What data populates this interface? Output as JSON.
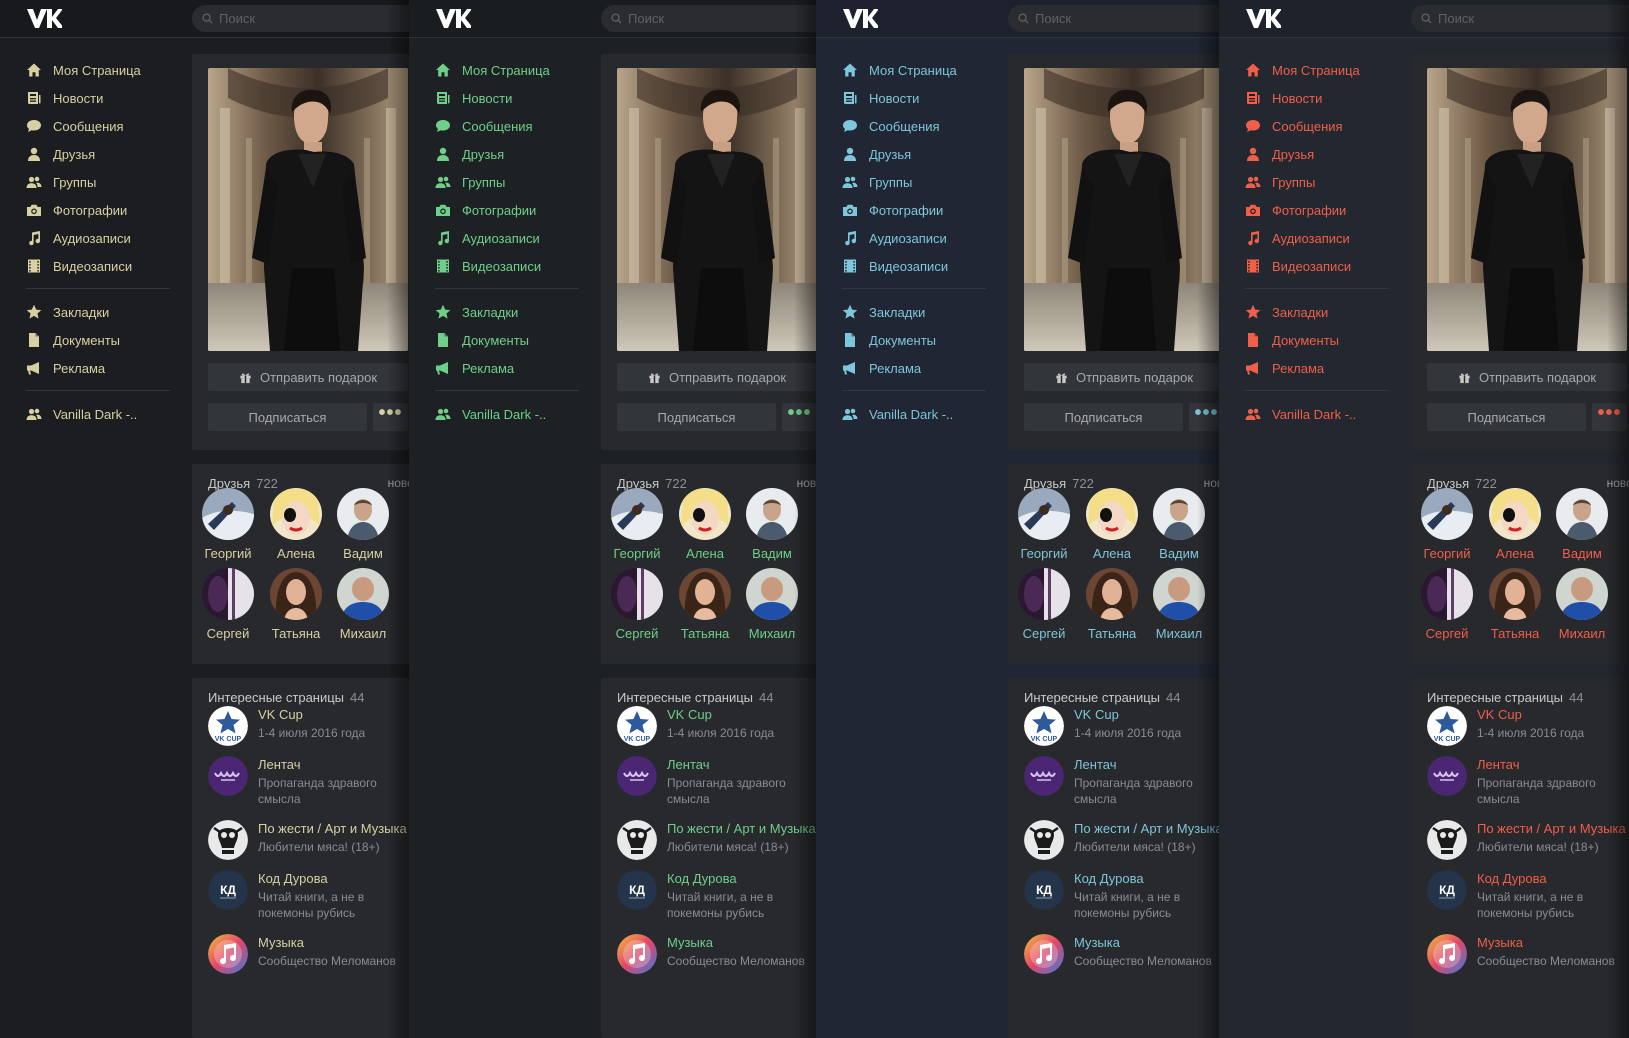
{
  "search": {
    "placeholder": "Поиск"
  },
  "nav": {
    "my_page": "Моя Страница",
    "news": "Новости",
    "messages": "Сообщения",
    "friends": "Друзья",
    "groups": "Группы",
    "photos": "Фотографии",
    "audio": "Аудиозаписи",
    "video": "Видеозаписи",
    "bookmarks": "Закладки",
    "documents": "Документы",
    "ads": "Реклама",
    "group_link": "Vanilla Dark -.."
  },
  "profile": {
    "gift_label": "Отправить подарок",
    "subscribe_label": "Подписаться",
    "more_label": "•••"
  },
  "friends": {
    "title": "Друзья",
    "count": "722",
    "link": "новости",
    "names": [
      "Георгий",
      "Алена",
      "Вадим",
      "Сергей",
      "Татьяна",
      "Михаил"
    ]
  },
  "pages": {
    "title": "Интересные страницы",
    "count": "44",
    "items": [
      {
        "name": "VK Cup",
        "desc": "1-4 июля 2016 года"
      },
      {
        "name": "Лентач",
        "desc": "Пропаганда здравого смысла"
      },
      {
        "name": "По жести / Арт и Музыка",
        "desc": "Любители мяса! (18+)"
      },
      {
        "name": "Код Дурова",
        "desc": "Читай книги, а не в покемоны рубись"
      },
      {
        "name": "Музыка",
        "desc": "Сообщество Меломанов"
      }
    ]
  },
  "themes": [
    {
      "name": "gold",
      "accent": "#d7d0a4"
    },
    {
      "name": "green",
      "accent": "#6fcf8a"
    },
    {
      "name": "cyan",
      "accent": "#7ec6d9"
    },
    {
      "name": "red",
      "accent": "#ef5f4a"
    }
  ]
}
